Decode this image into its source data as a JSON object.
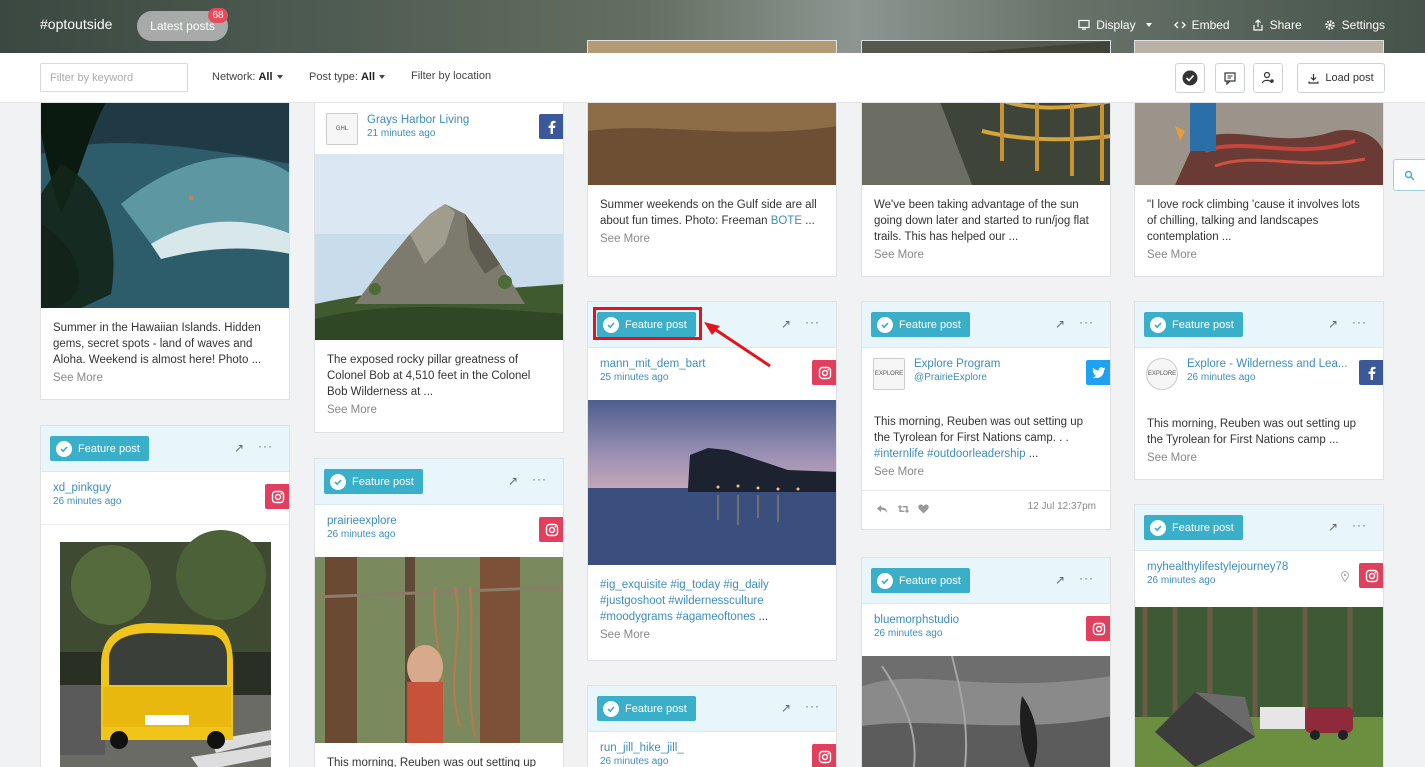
{
  "header": {
    "brand": "#optoutside",
    "latest_label": "Latest posts",
    "latest_count": "68",
    "nav": [
      {
        "label": "Display",
        "icon": "monitor-icon"
      },
      {
        "label": "Embed",
        "icon": "code-icon"
      },
      {
        "label": "Share",
        "icon": "share-icon"
      },
      {
        "label": "Settings",
        "icon": "gear-icon"
      }
    ]
  },
  "filters": {
    "keyword_placeholder": "Filter by keyword",
    "network_label": "Network:",
    "network_value": "All",
    "posttype_label": "Post type:",
    "posttype_value": "All",
    "location_label": "Filter by location",
    "load_label": "Load post"
  },
  "feature_label": "Feature post",
  "see_more": "See More",
  "cards": {
    "c1a": {
      "text": "Summer in the Hawaiian Islands. Hidden gems, secret spots - land of waves and Aloha. Weekend is almost here! Photo ..."
    },
    "c1b": {
      "author": "xd_pinkguy",
      "time": "26 minutes ago",
      "network": "instagram"
    },
    "c2a": {
      "author": "Grays Harbor Living",
      "time": "21 minutes ago",
      "network": "facebook",
      "text": "The exposed rocky pillar greatness of Colonel Bob at 4,510 feet in the Colonel Bob Wilderness at ..."
    },
    "c2b": {
      "author": "prairieexplore",
      "time": "26 minutes ago",
      "network": "instagram",
      "text": "This morning, Reuben was out setting up"
    },
    "c3a": {
      "text": "Summer weekends on the Gulf side are all about fun times. Photo: Freeman",
      "tag": "BOTE",
      "ellipsis": " ..."
    },
    "c3b": {
      "author": "mann_mit_dem_bart",
      "time": "25 minutes ago",
      "network": "instagram",
      "tags": "#ig_exquisite #ig_today #ig_daily #justgoshoot #wildernessculture #moodygrams #agameoftones",
      "ellipsis": " ..."
    },
    "c3c": {
      "author": "run_jill_hike_jill_",
      "time": "26 minutes ago",
      "network": "instagram"
    },
    "c4a": {
      "text": "We've been taking advantage of the sun going down later and started to run/jog flat trails. This has helped our ..."
    },
    "c4b": {
      "author": "Explore Program",
      "handle": "@PrairieExplore",
      "network": "twitter",
      "text": "This morning, Reuben was out setting up the Tyrolean for First Nations camp. . .",
      "tags": "#internlife #outdoorleadership",
      "ellipsis": " ...",
      "date": "12 Jul 12:37pm"
    },
    "c4c": {
      "author": "bluemorphstudio",
      "time": "26 minutes ago",
      "network": "instagram"
    },
    "c5a": {
      "text": "\"I love rock climbing 'cause it involves lots of chilling, talking and landscapes contemplation ..."
    },
    "c5b": {
      "author": "Explore - Wilderness and Lea...",
      "time": "26 minutes ago",
      "network": "facebook",
      "text": "This morning, Reuben was out setting up the Tyrolean for First Nations camp ..."
    },
    "c5c": {
      "author": "myhealthylifestylejourney78",
      "time": "26 minutes ago",
      "network": "instagram"
    }
  },
  "colors": {
    "accent": "#3aafc9",
    "link": "#3c8dbc",
    "instagram": "#e0405e",
    "facebook": "#3b5998",
    "twitter": "#1da1f2",
    "highlight": "#e3141c"
  }
}
